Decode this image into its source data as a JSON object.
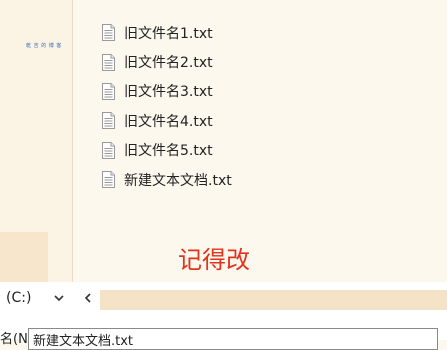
{
  "watermark": "乾 吉 的 博 客",
  "files": [
    {
      "name": "旧文件名1.txt"
    },
    {
      "name": "旧文件名2.txt"
    },
    {
      "name": "旧文件名3.txt"
    },
    {
      "name": "旧文件名4.txt"
    },
    {
      "name": "旧文件名5.txt"
    },
    {
      "name": "新建文本文档.txt"
    }
  ],
  "annotation": "记得改",
  "nav": {
    "drive_label": "(C:)",
    "chevron_down_icon": "chevron-down-icon",
    "chevron_left_icon": "chevron-left-icon"
  },
  "filename": {
    "label": "名(N):",
    "value": "新建文本文档.txt"
  },
  "colors": {
    "accent_red": "#e0341e",
    "sidebar_bg": "#fbf3e3",
    "scroll_track": "#f5e3c8"
  }
}
